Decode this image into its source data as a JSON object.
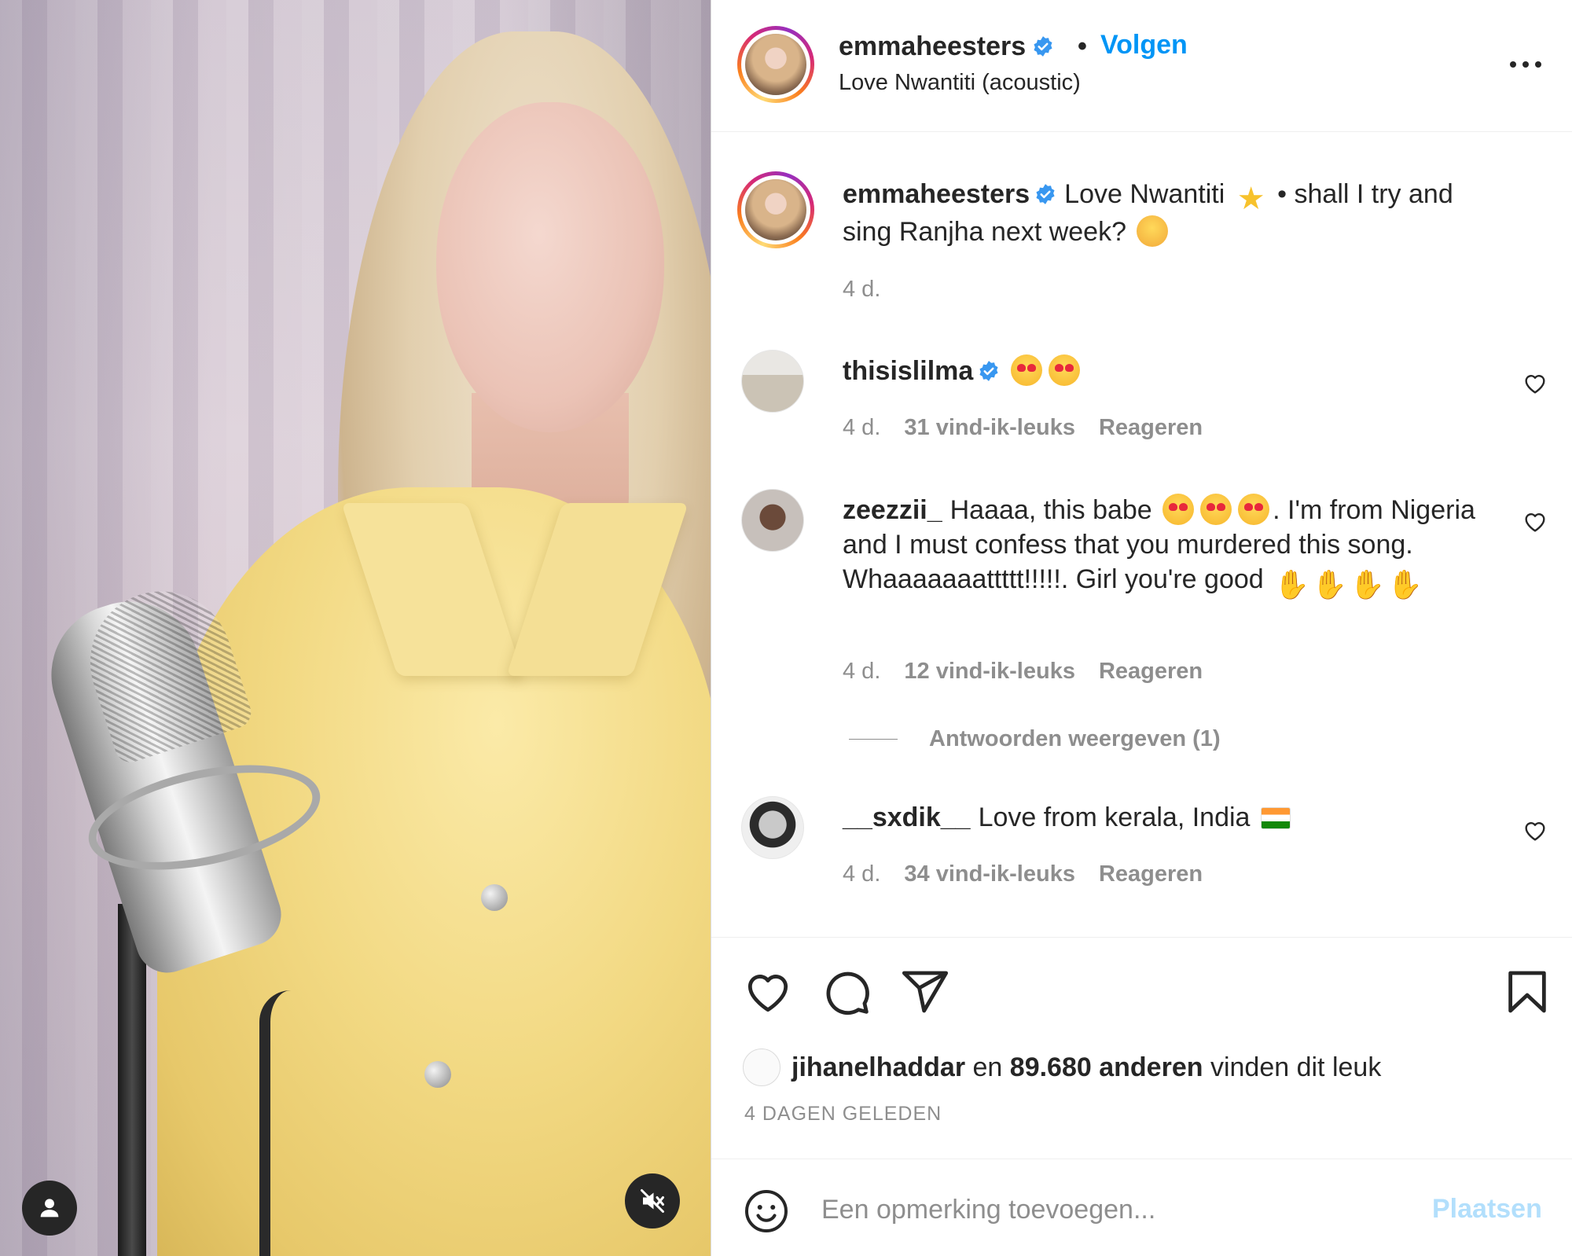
{
  "colors": {
    "accent": "#0095f6",
    "text": "#262626",
    "muted": "#8e8e8e",
    "post_disabled": "#b2dffc",
    "verified": "#3897f0"
  },
  "media": {
    "profile_icon": "user-icon",
    "mute_icon": "speaker-muted-icon"
  },
  "header": {
    "username": "emmaheesters",
    "separator": "•",
    "follow_label": "Volgen",
    "audio": "Love Nwantiti (acoustic)",
    "more_icon": "more-horizontal-icon"
  },
  "caption": {
    "username": "emmaheesters",
    "text_1": "Love Nwantiti",
    "text_2": "• shall I try and sing Ranjha next week?",
    "time": "4 d."
  },
  "comments": [
    {
      "username": "thisislilma",
      "verified": true,
      "text": "",
      "time": "4 d.",
      "likes": "31 vind-ik-leuks",
      "reply": "Reageren"
    },
    {
      "username": "zeezzii_",
      "verified": false,
      "text_1": "Haaaa, this babe",
      "text_2": ". I'm from Nigeria and I must confess that you murdered this song. Whaaaaaaattttt!!!!!. Girl you're good",
      "time": "4 d.",
      "likes": "12 vind-ik-leuks",
      "reply": "Reageren"
    },
    {
      "username": "__sxdik__",
      "verified": false,
      "text": "Love from kerala, India",
      "time": "4 d.",
      "likes": "34 vind-ik-leuks",
      "reply": "Reageren"
    }
  ],
  "view_replies": "Antwoorden weergeven (1)",
  "likes": {
    "user": "jihanelhaddar",
    "conj": "en",
    "count": "89.680 anderen",
    "suffix": "vinden dit leuk"
  },
  "posted": "4 dagen geleden",
  "comment_box": {
    "placeholder": "Een opmerking toevoegen...",
    "post_label": "Plaatsen"
  }
}
